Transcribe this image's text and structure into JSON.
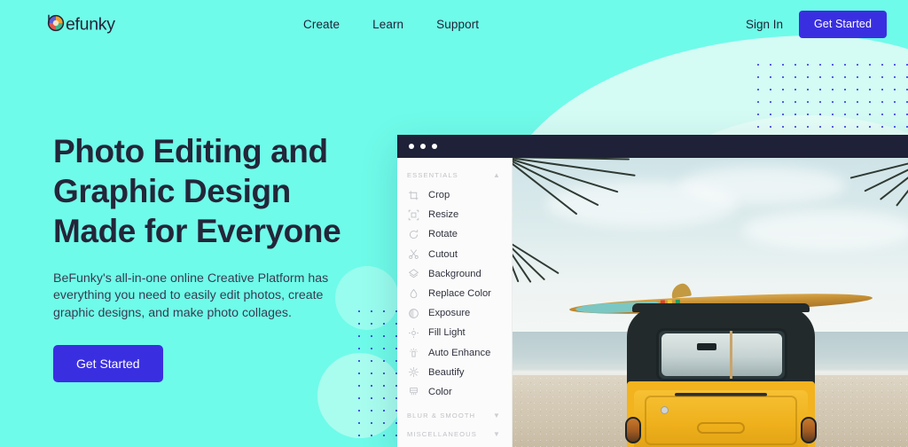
{
  "brand": {
    "name": "befunky",
    "logo_icon": "befunky-pinwheel-logo"
  },
  "header": {
    "nav": [
      {
        "label": "Create"
      },
      {
        "label": "Learn"
      },
      {
        "label": "Support"
      }
    ],
    "sign_in_label": "Sign In",
    "get_started_label": "Get Started",
    "accent_color": "#3a2fe0"
  },
  "hero": {
    "heading_line1": "Photo Editing and",
    "heading_line2": "Graphic Design",
    "heading_line3": "Made for Everyone",
    "paragraph": "BeFunky's all-in-one online Creative Platform has everything you need to easily edit photos, create graphic designs, and make photo collages.",
    "cta_label": "Get Started",
    "background_color": "#6ffbe9",
    "heading_color": "#242639"
  },
  "editor": {
    "titlebar": {
      "dots": 3,
      "color": "#1f2138"
    },
    "sections": [
      {
        "title": "ESSENTIALS",
        "expanded": true,
        "chevron": "chevron-up-icon",
        "items": [
          {
            "label": "Crop",
            "icon": "crop-icon"
          },
          {
            "label": "Resize",
            "icon": "resize-icon"
          },
          {
            "label": "Rotate",
            "icon": "rotate-icon"
          },
          {
            "label": "Cutout",
            "icon": "scissors-icon"
          },
          {
            "label": "Background",
            "icon": "layers-icon"
          },
          {
            "label": "Replace Color",
            "icon": "droplet-icon"
          },
          {
            "label": "Exposure",
            "icon": "exposure-icon"
          },
          {
            "label": "Fill Light",
            "icon": "fill-light-icon"
          },
          {
            "label": "Auto Enhance",
            "icon": "auto-enhance-icon"
          },
          {
            "label": "Beautify",
            "icon": "beautify-icon"
          },
          {
            "label": "Color",
            "icon": "color-icon"
          }
        ]
      },
      {
        "title": "BLUR & SMOOTH",
        "expanded": false,
        "chevron": "chevron-down-icon",
        "items": []
      },
      {
        "title": "MISCELLANEOUS",
        "expanded": false,
        "chevron": "chevron-down-icon",
        "items": []
      }
    ],
    "canvas": {
      "alt": "Yellow vintage van with surfboard on roof parked on a beach with palm fronds and ocean"
    }
  }
}
